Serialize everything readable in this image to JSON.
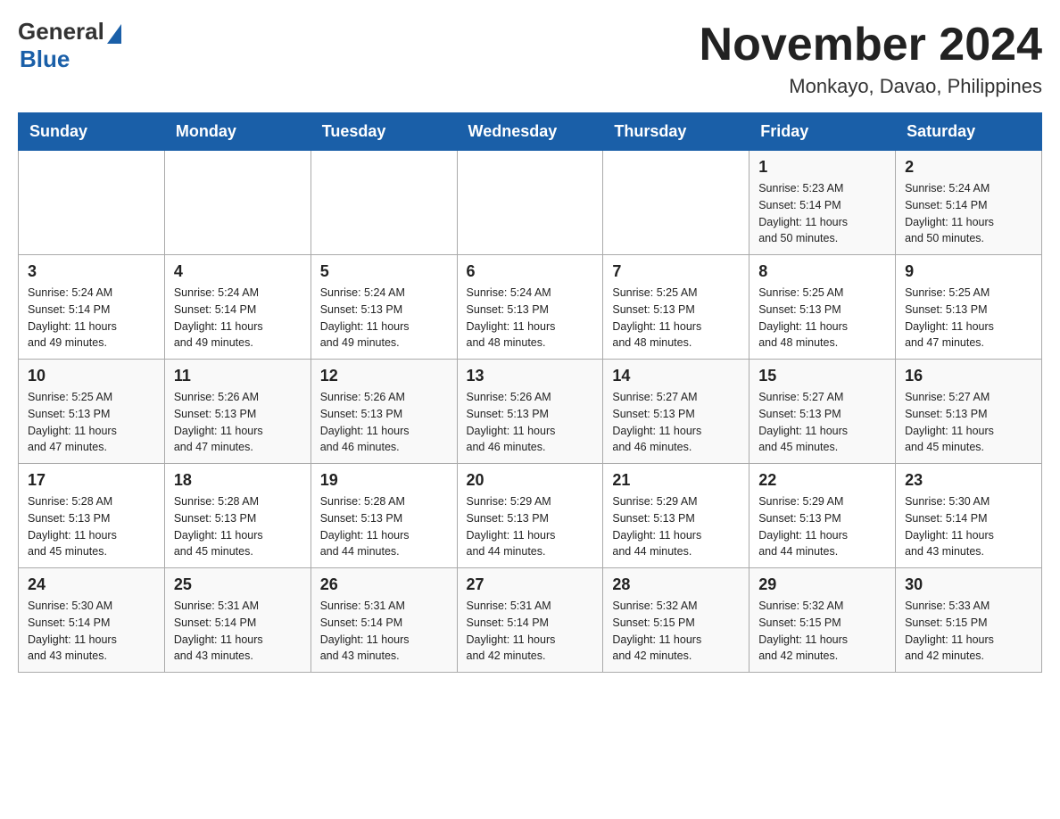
{
  "header": {
    "logo": {
      "general": "General",
      "blue": "Blue"
    },
    "title": "November 2024",
    "location": "Monkayo, Davao, Philippines"
  },
  "weekdays": [
    "Sunday",
    "Monday",
    "Tuesday",
    "Wednesday",
    "Thursday",
    "Friday",
    "Saturday"
  ],
  "weeks": [
    {
      "days": [
        {
          "number": "",
          "info": ""
        },
        {
          "number": "",
          "info": ""
        },
        {
          "number": "",
          "info": ""
        },
        {
          "number": "",
          "info": ""
        },
        {
          "number": "",
          "info": ""
        },
        {
          "number": "1",
          "info": "Sunrise: 5:23 AM\nSunset: 5:14 PM\nDaylight: 11 hours\nand 50 minutes."
        },
        {
          "number": "2",
          "info": "Sunrise: 5:24 AM\nSunset: 5:14 PM\nDaylight: 11 hours\nand 50 minutes."
        }
      ]
    },
    {
      "days": [
        {
          "number": "3",
          "info": "Sunrise: 5:24 AM\nSunset: 5:14 PM\nDaylight: 11 hours\nand 49 minutes."
        },
        {
          "number": "4",
          "info": "Sunrise: 5:24 AM\nSunset: 5:14 PM\nDaylight: 11 hours\nand 49 minutes."
        },
        {
          "number": "5",
          "info": "Sunrise: 5:24 AM\nSunset: 5:13 PM\nDaylight: 11 hours\nand 49 minutes."
        },
        {
          "number": "6",
          "info": "Sunrise: 5:24 AM\nSunset: 5:13 PM\nDaylight: 11 hours\nand 48 minutes."
        },
        {
          "number": "7",
          "info": "Sunrise: 5:25 AM\nSunset: 5:13 PM\nDaylight: 11 hours\nand 48 minutes."
        },
        {
          "number": "8",
          "info": "Sunrise: 5:25 AM\nSunset: 5:13 PM\nDaylight: 11 hours\nand 48 minutes."
        },
        {
          "number": "9",
          "info": "Sunrise: 5:25 AM\nSunset: 5:13 PM\nDaylight: 11 hours\nand 47 minutes."
        }
      ]
    },
    {
      "days": [
        {
          "number": "10",
          "info": "Sunrise: 5:25 AM\nSunset: 5:13 PM\nDaylight: 11 hours\nand 47 minutes."
        },
        {
          "number": "11",
          "info": "Sunrise: 5:26 AM\nSunset: 5:13 PM\nDaylight: 11 hours\nand 47 minutes."
        },
        {
          "number": "12",
          "info": "Sunrise: 5:26 AM\nSunset: 5:13 PM\nDaylight: 11 hours\nand 46 minutes."
        },
        {
          "number": "13",
          "info": "Sunrise: 5:26 AM\nSunset: 5:13 PM\nDaylight: 11 hours\nand 46 minutes."
        },
        {
          "number": "14",
          "info": "Sunrise: 5:27 AM\nSunset: 5:13 PM\nDaylight: 11 hours\nand 46 minutes."
        },
        {
          "number": "15",
          "info": "Sunrise: 5:27 AM\nSunset: 5:13 PM\nDaylight: 11 hours\nand 45 minutes."
        },
        {
          "number": "16",
          "info": "Sunrise: 5:27 AM\nSunset: 5:13 PM\nDaylight: 11 hours\nand 45 minutes."
        }
      ]
    },
    {
      "days": [
        {
          "number": "17",
          "info": "Sunrise: 5:28 AM\nSunset: 5:13 PM\nDaylight: 11 hours\nand 45 minutes."
        },
        {
          "number": "18",
          "info": "Sunrise: 5:28 AM\nSunset: 5:13 PM\nDaylight: 11 hours\nand 45 minutes."
        },
        {
          "number": "19",
          "info": "Sunrise: 5:28 AM\nSunset: 5:13 PM\nDaylight: 11 hours\nand 44 minutes."
        },
        {
          "number": "20",
          "info": "Sunrise: 5:29 AM\nSunset: 5:13 PM\nDaylight: 11 hours\nand 44 minutes."
        },
        {
          "number": "21",
          "info": "Sunrise: 5:29 AM\nSunset: 5:13 PM\nDaylight: 11 hours\nand 44 minutes."
        },
        {
          "number": "22",
          "info": "Sunrise: 5:29 AM\nSunset: 5:13 PM\nDaylight: 11 hours\nand 44 minutes."
        },
        {
          "number": "23",
          "info": "Sunrise: 5:30 AM\nSunset: 5:14 PM\nDaylight: 11 hours\nand 43 minutes."
        }
      ]
    },
    {
      "days": [
        {
          "number": "24",
          "info": "Sunrise: 5:30 AM\nSunset: 5:14 PM\nDaylight: 11 hours\nand 43 minutes."
        },
        {
          "number": "25",
          "info": "Sunrise: 5:31 AM\nSunset: 5:14 PM\nDaylight: 11 hours\nand 43 minutes."
        },
        {
          "number": "26",
          "info": "Sunrise: 5:31 AM\nSunset: 5:14 PM\nDaylight: 11 hours\nand 43 minutes."
        },
        {
          "number": "27",
          "info": "Sunrise: 5:31 AM\nSunset: 5:14 PM\nDaylight: 11 hours\nand 42 minutes."
        },
        {
          "number": "28",
          "info": "Sunrise: 5:32 AM\nSunset: 5:15 PM\nDaylight: 11 hours\nand 42 minutes."
        },
        {
          "number": "29",
          "info": "Sunrise: 5:32 AM\nSunset: 5:15 PM\nDaylight: 11 hours\nand 42 minutes."
        },
        {
          "number": "30",
          "info": "Sunrise: 5:33 AM\nSunset: 5:15 PM\nDaylight: 11 hours\nand 42 minutes."
        }
      ]
    }
  ]
}
